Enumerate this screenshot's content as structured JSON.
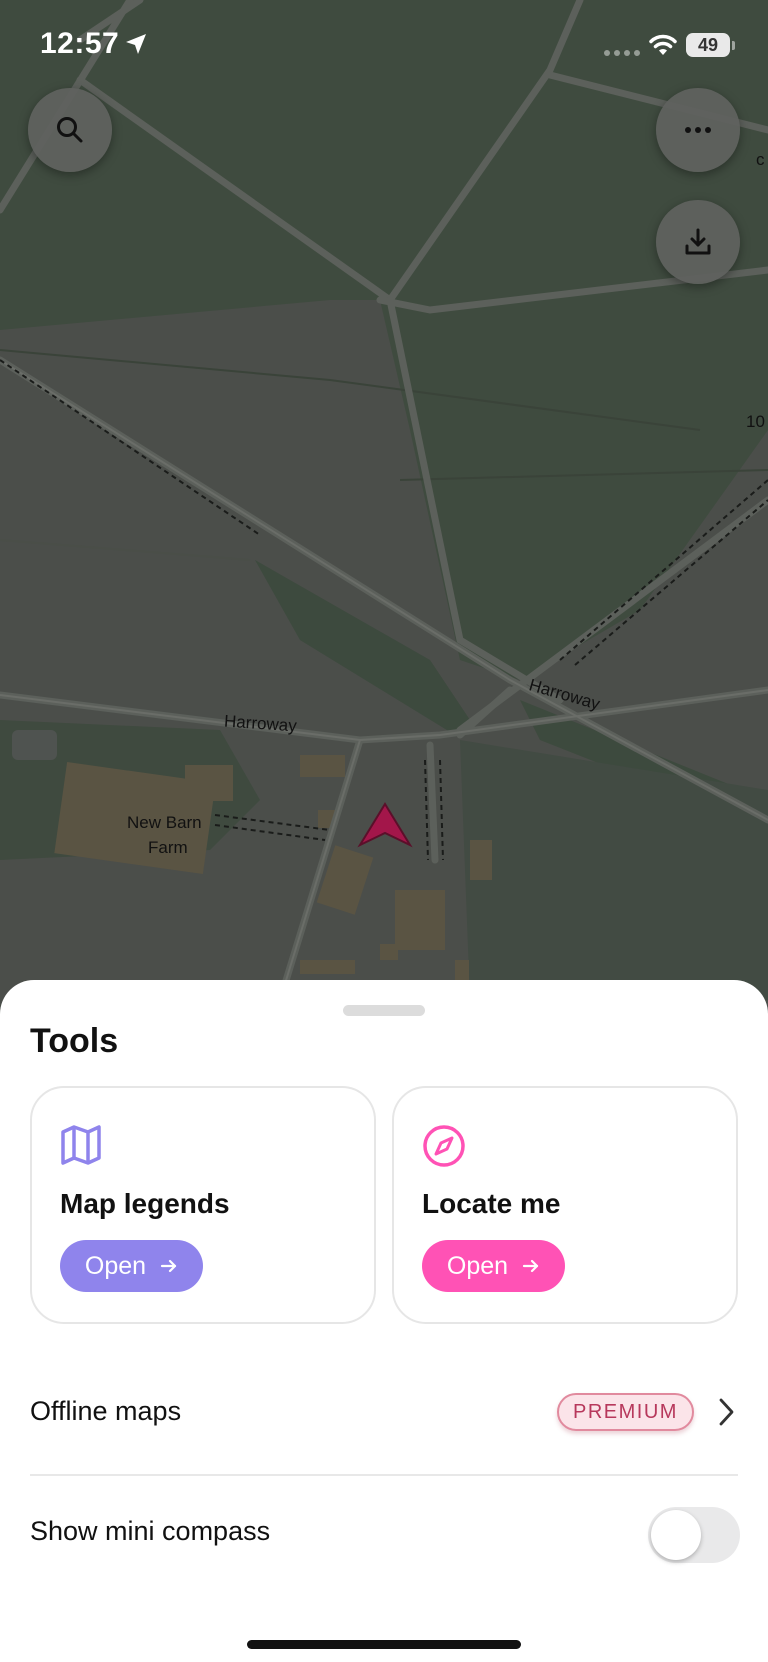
{
  "status_bar": {
    "time": "12:57",
    "battery": "49"
  },
  "map": {
    "labels": {
      "road_left": "Harroway",
      "road_right": "Harroway",
      "farm_line1": "New Barn",
      "farm_line2": "Farm",
      "edge_top": "c",
      "edge_mid": "10"
    },
    "buttons": {
      "search": "search-icon",
      "more": "more-icon",
      "download": "download-icon"
    },
    "colors": {
      "woodland": "#3f4b3f",
      "field": "#4b4e4a",
      "position_marker": "#a3164a"
    }
  },
  "sheet": {
    "title": "Tools",
    "cards": [
      {
        "title": "Map legends",
        "button": "Open",
        "icon": "map-icon",
        "color": "#8f84ec"
      },
      {
        "title": "Locate me",
        "button": "Open",
        "icon": "compass-icon",
        "color": "#ff52b5"
      }
    ],
    "offline": {
      "label": "Offline maps",
      "badge": "PREMIUM"
    },
    "compass": {
      "label": "Show mini compass",
      "enabled": false
    }
  }
}
